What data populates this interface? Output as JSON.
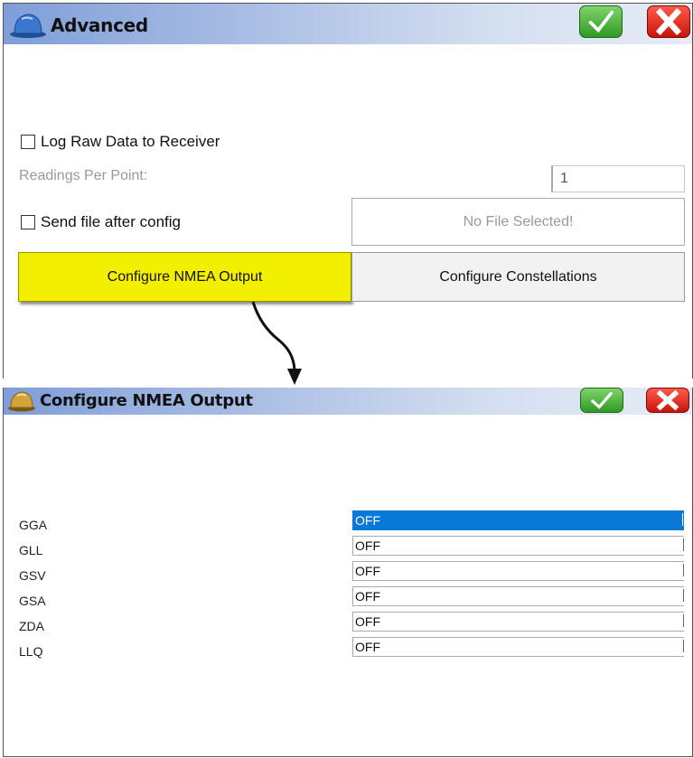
{
  "advanced": {
    "title": "Advanced",
    "log_raw_label": "Log Raw Data to Receiver",
    "readings_label": "Readings Per Point:",
    "readings_value": "1",
    "send_file_label": "Send file after config",
    "file_button_label": "No File Selected!",
    "configure_nmea_label": "Configure NMEA Output",
    "configure_constellations_label": "Configure Constellations",
    "highlight_color": "#f2ef00"
  },
  "nmea": {
    "title": "Configure NMEA Output",
    "rows": [
      {
        "label": "GGA",
        "value": "OFF",
        "selected": true
      },
      {
        "label": "GLL",
        "value": "OFF",
        "selected": false
      },
      {
        "label": "GSV",
        "value": "OFF",
        "selected": false
      },
      {
        "label": "GSA",
        "value": "OFF",
        "selected": false
      },
      {
        "label": "ZDA",
        "value": "OFF",
        "selected": false
      },
      {
        "label": "LLQ",
        "value": "OFF",
        "selected": false
      }
    ],
    "selection_color": "#0a78d7"
  },
  "icons": {
    "title_icon": "hard-hat-icon",
    "ok_icon": "checkmark-icon",
    "cancel_icon": "close-icon"
  }
}
